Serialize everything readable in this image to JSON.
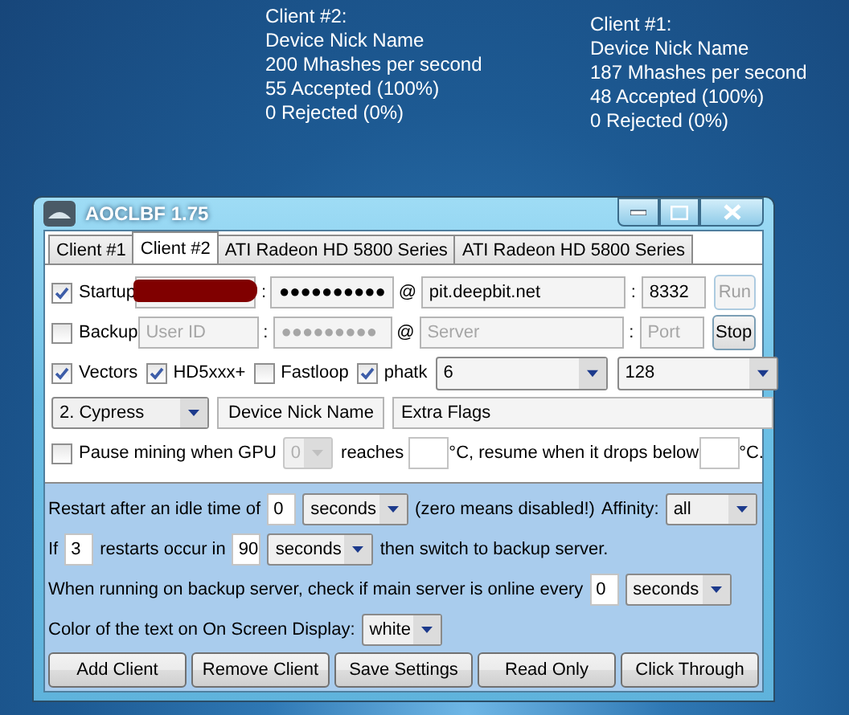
{
  "osd": [
    {
      "lines": [
        "Client #2:",
        "Device Nick Name",
        "200 Mhashes per second",
        "55 Accepted (100%)",
        "0 Rejected (0%)"
      ]
    },
    {
      "lines": [
        "Client #1:",
        "Device Nick Name",
        "187 Mhashes per second",
        "48 Accepted (100%)",
        "0 Rejected (0%)"
      ]
    }
  ],
  "window": {
    "title": "AOCLBF 1.75"
  },
  "tabs": [
    {
      "label": "Client #1",
      "selected": false
    },
    {
      "label": "Client #2",
      "selected": true
    },
    {
      "label": "ATI Radeon HD 5800 Series",
      "selected": false
    },
    {
      "label": "ATI Radeon HD 5800 Series",
      "selected": false
    }
  ],
  "servers": [
    {
      "label": "Startup",
      "checked": true,
      "user": {
        "redacted": true
      },
      "user_sep": ":",
      "password": {
        "value": "●●●●●●●●●●"
      },
      "host_sep": "@",
      "server": {
        "value": "pit.deepbit.net"
      },
      "port_sep": ":",
      "port": {
        "value": "8332"
      },
      "button": {
        "label": "Run",
        "disabled": true
      }
    },
    {
      "label": "Backup",
      "checked": false,
      "user": {
        "placeholder": "User ID"
      },
      "user_sep": ":",
      "password": {
        "placeholder": "●●●●●●●●●"
      },
      "host_sep": "@",
      "server": {
        "placeholder": "Server"
      },
      "port_sep": ":",
      "port": {
        "placeholder": "Port"
      },
      "button": {
        "label": "Stop",
        "disabled": false
      }
    }
  ],
  "options": [
    {
      "label": "Vectors",
      "checked": true
    },
    {
      "label": "HD5xxx+",
      "checked": true
    },
    {
      "label": "Fastloop",
      "checked": false
    },
    {
      "label": "phatk",
      "checked": true
    }
  ],
  "select_1": "6",
  "select_2": "128",
  "device": "2. Cypress",
  "nick_name": "Device Nick Name",
  "extra_flags": "Extra Flags",
  "pause": {
    "label": "Pause mining when GPU",
    "checked": false,
    "gpu": {
      "value": "0",
      "disabled": true
    },
    "text_1": "reaches",
    "text_2": "°C, resume when it drops below",
    "text_3": "°C."
  },
  "restart": {
    "text_1": "Restart after an idle time of",
    "value": "0",
    "unit": "seconds",
    "note": "(zero means disabled!)",
    "affinity_label": "Affinity:",
    "affinity": "all"
  },
  "failover": {
    "text_1": "If",
    "count": "3",
    "text_2": "restarts occur in",
    "time": "90",
    "unit": "seconds",
    "text_3": "then switch to backup server."
  },
  "recheck": {
    "text": "When running on backup server, check if main server is online every",
    "value": "0",
    "unit": "seconds"
  },
  "osd_color": {
    "label": "Color of the text on On Screen Display:",
    "value": "white"
  },
  "buttons": [
    "Add Client",
    "Remove Client",
    "Save Settings",
    "Read Only",
    "Click Through"
  ]
}
